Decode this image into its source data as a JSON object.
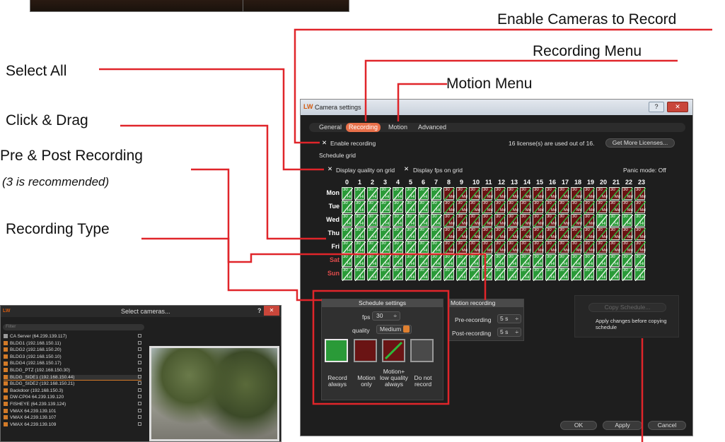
{
  "annotations": {
    "enable_cameras": "Enable Cameras to Record",
    "recording_menu": "Recording Menu",
    "motion_menu": "Motion Menu",
    "select_all": "Select All",
    "click_drag": "Click & Drag",
    "pre_post": "Pre & Post Recording",
    "pre_post_note": "(3 is recommended)",
    "recording_type": "Recording Type"
  },
  "camera_settings": {
    "logo": "LW",
    "title": "Camera settings",
    "help_btn": "?",
    "close_btn": "✕",
    "tabs": [
      "General",
      "Recording",
      "Motion",
      "Advanced"
    ],
    "enable_recording": "Enable recording",
    "license_text": "16 license(s) are used out of 16.",
    "get_more": "Get More Licenses...",
    "schedule_grid": "Schedule grid",
    "display_quality": "Display quality on grid",
    "display_fps": "Display fps on grid",
    "panic_mode": "Panic mode: Off",
    "hours": [
      "0",
      "1",
      "2",
      "3",
      "4",
      "5",
      "6",
      "7",
      "8",
      "9",
      "10",
      "11",
      "12",
      "13",
      "14",
      "15",
      "16",
      "17",
      "18",
      "19",
      "20",
      "21",
      "22",
      "23"
    ],
    "days": [
      "Mon",
      "Tue",
      "Wed",
      "Thu",
      "Fri",
      "Sat",
      "Sun"
    ],
    "cell_fps": "30",
    "cell_quality_hi": "Hi",
    "cell_quality_md": "Md",
    "schedule_settings": {
      "header": "Schedule settings",
      "fps_label": "fps",
      "fps_value": "30",
      "quality_label": "quality",
      "quality_value": "Medium",
      "types": [
        "Record always",
        "Motion only",
        "Motion+ low quality always",
        "Do not record"
      ]
    },
    "motion_recording": {
      "header": "Motion recording",
      "pre_label": "Pre-recording",
      "pre_value": "5 s",
      "post_label": "Post-recording",
      "post_value": "5 s"
    },
    "copy_schedule": "Copy Schedule...",
    "copy_note": "Apply changes before copying schedule",
    "ok": "OK",
    "apply": "Apply",
    "cancel": "Cancel"
  },
  "select_cameras": {
    "title": "Select cameras...",
    "help": "?",
    "close": "✕",
    "filter_placeholder": "Filter",
    "items": [
      "CA Server (64.239.139.117)",
      "BLDG1 (192.168.150.11)",
      "BLDG2 (192.168.150.20)",
      "BLDG3 (192.168.150.10)",
      "BLDG4 (192.168.150.17)",
      "BLDG_PTZ (192.168.150.30)",
      "BLDG_SIDE1 (192.168.150.44)",
      "BLDG_SIDE2 (192.168.150.21)",
      "Backdoor (192.168.150.3)",
      "DW-CP04 64.239.139.120",
      "FISHEYE (64.239.139.124)",
      "VMAX 64.239.139.101",
      "VMAX 64.239.139.107",
      "VMAX 64.239.139.109"
    ]
  },
  "colors": {
    "accent": "#e8704a",
    "callout_line": "#e0252a",
    "green": "#2a9a38",
    "red": "#6a1414"
  }
}
